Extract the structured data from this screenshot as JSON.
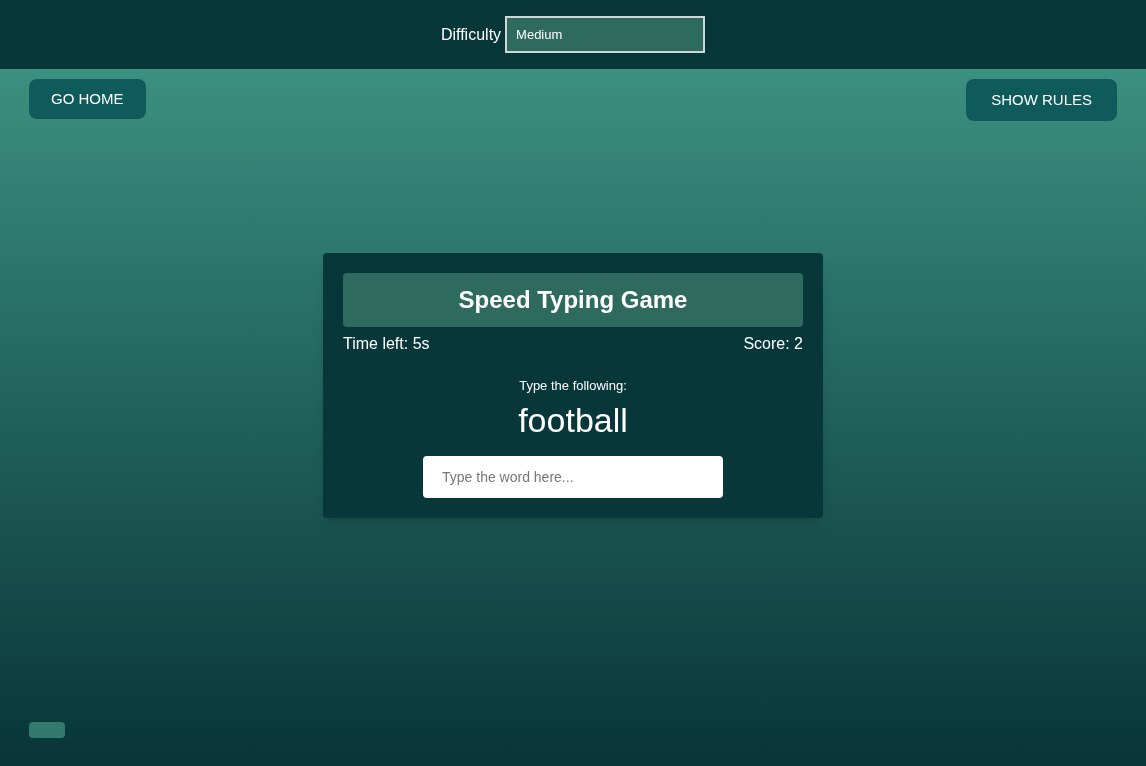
{
  "header": {
    "difficulty_label": "Difficulty",
    "difficulty_value": "Medium"
  },
  "nav": {
    "home_button": "GO HOME",
    "rules_button": "SHOW RULES"
  },
  "game": {
    "title": "Speed Typing Game",
    "time_left": "Time left: 5s",
    "score": "Score: 2",
    "prompt": "Type the following:",
    "word": "football",
    "input": {
      "placeholder": "Type the word here..."
    }
  }
}
